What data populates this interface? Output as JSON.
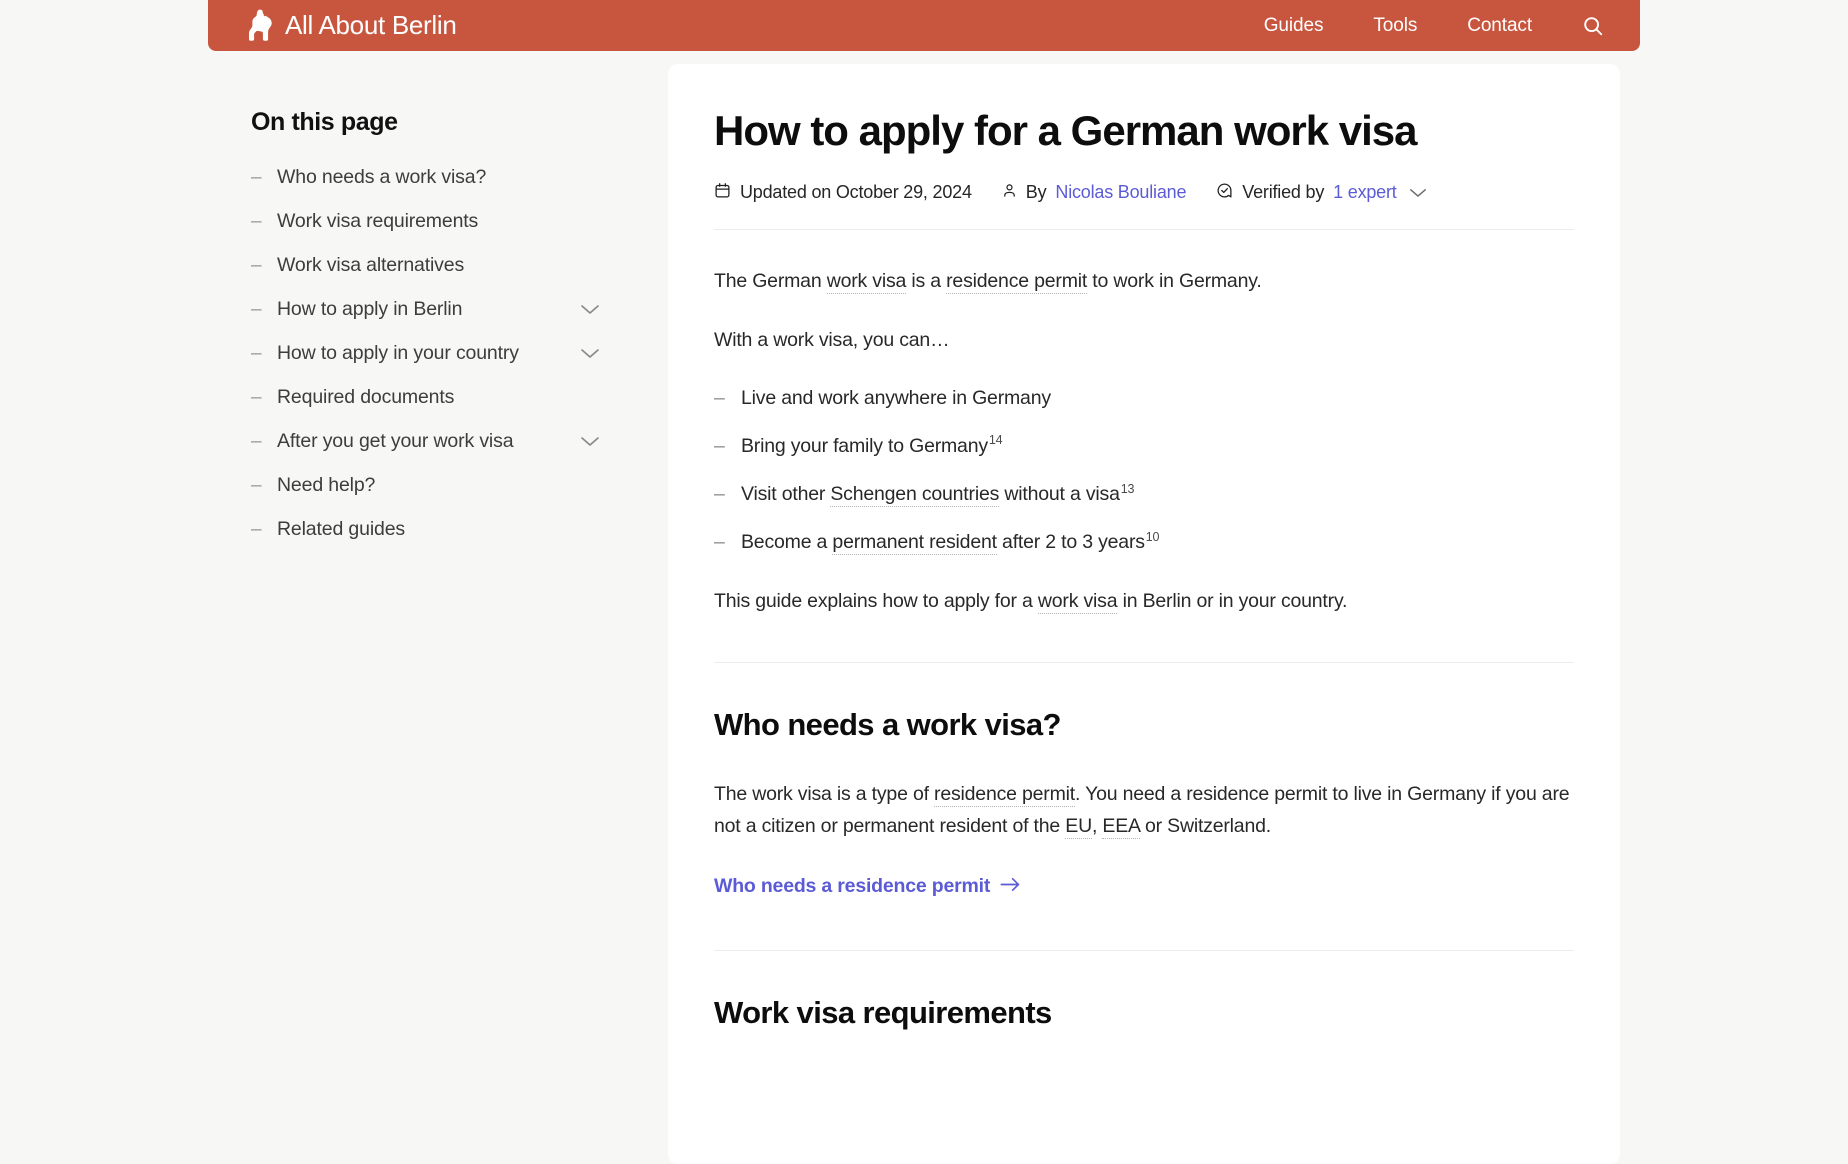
{
  "theme": {
    "header_bg": "#c8563f",
    "page_bg": "#f7f7f6",
    "card_bg": "#ffffff",
    "link_accent": "#5b5bd6"
  },
  "header": {
    "brand": "All About Berlin",
    "logo_icon": "berlin-bear-icon",
    "nav": [
      {
        "label": "Guides"
      },
      {
        "label": "Tools"
      },
      {
        "label": "Contact"
      }
    ],
    "search_icon": "search-icon"
  },
  "sidebar": {
    "title": "On this page",
    "bullet": "–",
    "items": [
      {
        "label": "Who needs a work visa?",
        "expandable": false
      },
      {
        "label": "Work visa requirements",
        "expandable": false
      },
      {
        "label": "Work visa alternatives",
        "expandable": false
      },
      {
        "label": "How to apply in Berlin",
        "expandable": true
      },
      {
        "label": "How to apply in your country",
        "expandable": true
      },
      {
        "label": "Required documents",
        "expandable": false
      },
      {
        "label": "After you get your work visa",
        "expandable": true
      },
      {
        "label": "Need help?",
        "expandable": false
      },
      {
        "label": "Related guides",
        "expandable": false
      }
    ]
  },
  "article": {
    "title": "How to apply for a German work visa",
    "meta": {
      "calendar_icon": "calendar-icon",
      "updated": "Updated on October 29, 2024",
      "person_icon": "person-icon",
      "by_prefix": "By",
      "author": "Nicolas Bouliane",
      "verified_icon": "verified-check-icon",
      "verified_prefix": "Verified by",
      "verified_link": "1 expert",
      "verified_chevron_icon": "chevron-down-icon"
    },
    "intro": {
      "p1_a": "The German ",
      "p1_link1": "work visa",
      "p1_b": " is a ",
      "p1_link2": "residence permit",
      "p1_c": " to work in Germany.",
      "p2": "With a work visa, you can…"
    },
    "benefits": {
      "bullet": "–",
      "items": [
        {
          "text": "Live and work anywhere in Germany",
          "sup": "",
          "link": ""
        },
        {
          "text": "Bring your family to Germany",
          "sup": "14",
          "link": ""
        },
        {
          "pre": "Visit other ",
          "link": "Schengen countries",
          "post": " without a visa",
          "sup": "13"
        },
        {
          "pre": "Become a ",
          "link": "permanent resident",
          "post": " after 2 to 3 years",
          "sup": "10"
        }
      ]
    },
    "closing": {
      "a": "This guide explains how to apply for a ",
      "link": "work visa",
      "b": " in Berlin or in your country."
    },
    "sections": [
      {
        "heading": "Who needs a work visa?",
        "body_a": "The work visa is a type of ",
        "body_link1": "residence permit",
        "body_b": ". You need a residence permit to live in Germany if you are not a citizen or permanent resident of the ",
        "body_link2": "EU",
        "body_c": ", ",
        "body_link3": "EEA",
        "body_d": " or Switzerland.",
        "cta_label": "Who needs a residence permit",
        "cta_icon": "arrow-right-icon"
      },
      {
        "heading": "Work visa requirements"
      }
    ]
  }
}
